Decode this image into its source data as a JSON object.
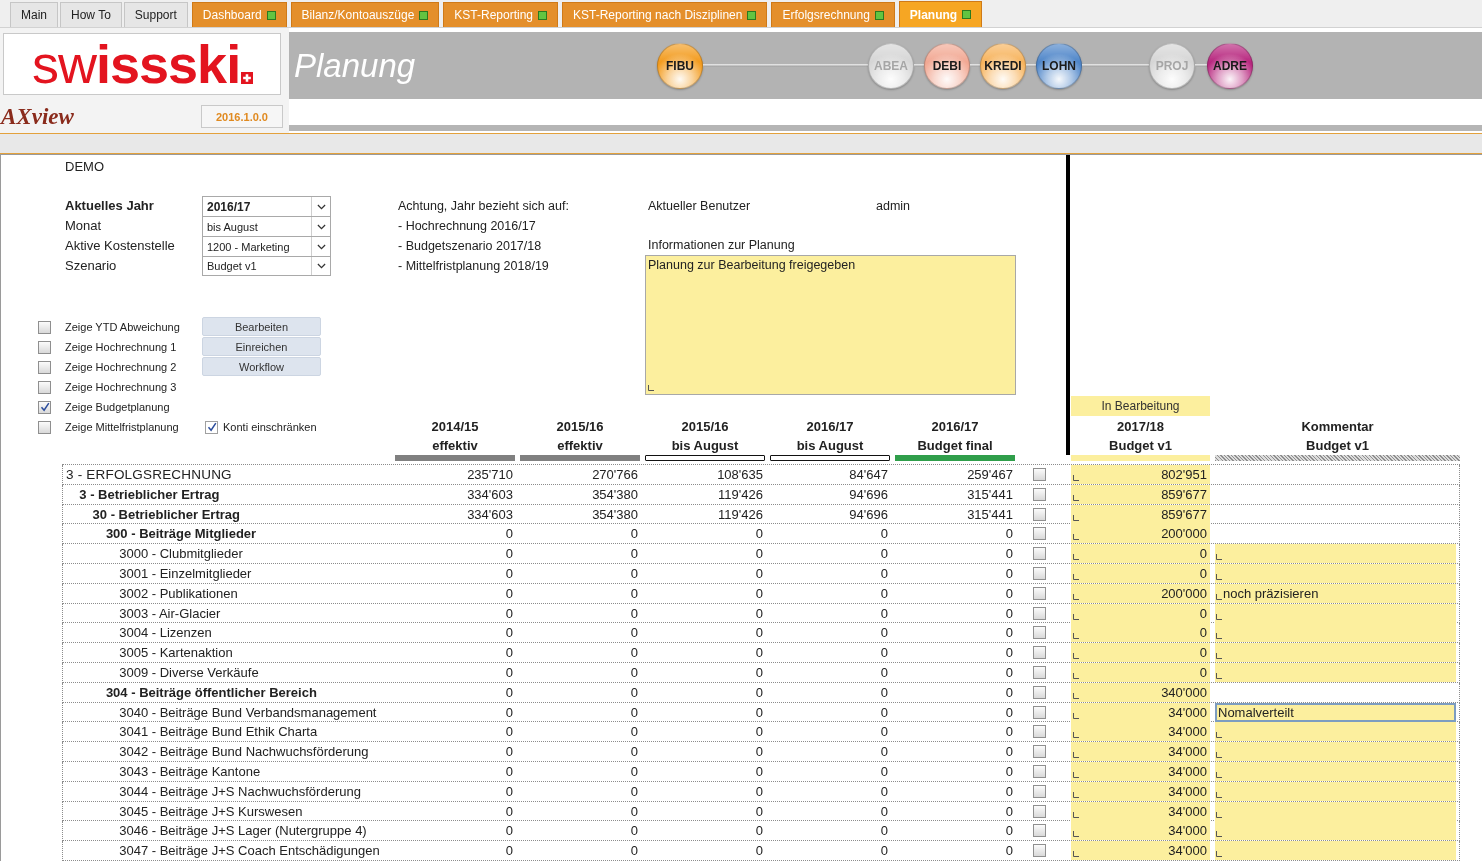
{
  "tabs": [
    {
      "label": "Main",
      "kind": "link",
      "selected": false
    },
    {
      "label": "How To",
      "kind": "link",
      "selected": false
    },
    {
      "label": "Support",
      "kind": "link",
      "selected": false
    },
    {
      "label": "Dashboard",
      "kind": "module",
      "selected": false
    },
    {
      "label": "Bilanz/Kontoauszüge",
      "kind": "module",
      "selected": false
    },
    {
      "label": "KST-Reporting",
      "kind": "module",
      "selected": false
    },
    {
      "label": "KST-Reporting nach Disziplinen",
      "kind": "module",
      "selected": false
    },
    {
      "label": "Erfolgsrechnung",
      "kind": "module",
      "selected": false
    },
    {
      "label": "Planung",
      "kind": "module",
      "selected": true
    }
  ],
  "header": {
    "logo": "sw**issski**",
    "product": "**AX**view",
    "version": "2016.1.0.0",
    "title": "Planung",
    "modules": [
      {
        "label": "FIBU",
        "color": "#f39c1f",
        "disabled": false
      },
      {
        "label": "ABEA",
        "disabled": true
      },
      {
        "label": "DEBI",
        "color": "#f2a994",
        "disabled": false
      },
      {
        "label": "KREDI",
        "color": "#f7b45e",
        "disabled": false
      },
      {
        "label": "LOHN",
        "color": "#4f86c9",
        "disabled": false
      },
      {
        "label": "PROJ",
        "disabled": true
      },
      {
        "label": "ADRE",
        "color": "#b8287f",
        "disabled": false
      }
    ]
  },
  "client": "DEMO",
  "settings": [
    {
      "label": "Aktuelles Jahr",
      "value": "2016/17"
    },
    {
      "label": "Monat",
      "value": "bis August"
    },
    {
      "label": "Aktive Kostenstelle",
      "value": "1200 - Marketing"
    },
    {
      "label": "Szenario",
      "value": "Budget v1"
    }
  ],
  "notice": {
    "title": "Achtung, Jahr bezieht sich auf:",
    "items": [
      "- Hochrechnung 2016/17",
      "- Budgetszenario 2017/18",
      "- Mittelfristplanung 2018/19"
    ]
  },
  "user": {
    "label": "Aktueller Benutzer",
    "value": "admin"
  },
  "info": {
    "label": "Informationen zur Planung",
    "value": "Planung zur Bearbeitung freigegeben"
  },
  "options": [
    {
      "label": "Zeige YTD Abweichung",
      "checked": false
    },
    {
      "label": "Zeige Hochrechnung 1",
      "checked": false
    },
    {
      "label": "Zeige Hochrechnung 2",
      "checked": false
    },
    {
      "label": "Zeige Hochrechnung 3",
      "checked": false
    },
    {
      "label": "Zeige Budgetplanung",
      "checked": true
    },
    {
      "label": "Zeige Mittelfristplanung",
      "checked": false
    }
  ],
  "actions": [
    "Bearbeiten",
    "Einreichen",
    "Workflow"
  ],
  "restrict": {
    "label": "Konti einschränken",
    "checked": true
  },
  "columns": [
    {
      "year": "2014/15",
      "label": "effektiv",
      "kind": "solid",
      "color": "#808080"
    },
    {
      "year": "2015/16",
      "label": "effektiv",
      "kind": "solid",
      "color": "#808080"
    },
    {
      "year": "2015/16",
      "label": "bis August",
      "kind": "outline"
    },
    {
      "year": "2016/17",
      "label": "bis August",
      "kind": "outline"
    },
    {
      "year": "2016/17",
      "label": "Budget final",
      "kind": "solid",
      "color": "#2f9e4a"
    }
  ],
  "budget_column": {
    "status": "In Bearbeitung",
    "year": "2017/18",
    "label": "Budget v1"
  },
  "comment_column": {
    "title": "Kommentar",
    "label": "Budget v1"
  },
  "rows": [
    {
      "label": "3 - ERFOLGSRECHNUNG",
      "values": [
        "235'710",
        "270'766",
        "108'635",
        "84'647",
        "259'467"
      ],
      "checked": false,
      "budget": "802'951",
      "children": [
        {
          "label": "3 - Betrieblicher Ertrag",
          "values": [
            "334'603",
            "354'380",
            "119'426",
            "94'696",
            "315'441"
          ],
          "checked": false,
          "budget": "859'677",
          "children": [
            {
              "label": "30 - Betrieblicher Ertrag",
              "values": [
                "334'603",
                "354'380",
                "119'426",
                "94'696",
                "315'441"
              ],
              "checked": false,
              "budget": "859'677",
              "children": [
                {
                  "label": "300 - Beiträge Mitglieder",
                  "values": [
                    "0",
                    "0",
                    "0",
                    "0",
                    "0"
                  ],
                  "checked": false,
                  "budget": "200'000",
                  "children": [
                    {
                      "label": "3000 - Clubmitglieder",
                      "values": [
                        "0",
                        "0",
                        "0",
                        "0",
                        "0"
                      ],
                      "checked": false,
                      "budget": "0",
                      "comment_focused": false
                    },
                    {
                      "label": "3001 - Einzelmitglieder",
                      "values": [
                        "0",
                        "0",
                        "0",
                        "0",
                        "0"
                      ],
                      "checked": false,
                      "budget": "0",
                      "comment_focused": false
                    },
                    {
                      "label": "3002 - Publikationen",
                      "values": [
                        "0",
                        "0",
                        "0",
                        "0",
                        "0"
                      ],
                      "checked": false,
                      "budget": "200'000",
                      "comment": "noch präzisieren",
                      "comment_focused": false
                    },
                    {
                      "label": "3003 - Air-Glacier",
                      "values": [
                        "0",
                        "0",
                        "0",
                        "0",
                        "0"
                      ],
                      "checked": false,
                      "budget": "0",
                      "comment_focused": false
                    },
                    {
                      "label": "3004 - Lizenzen",
                      "values": [
                        "0",
                        "0",
                        "0",
                        "0",
                        "0"
                      ],
                      "checked": false,
                      "budget": "0",
                      "comment_focused": false
                    },
                    {
                      "label": "3005 - Kartenaktion",
                      "values": [
                        "0",
                        "0",
                        "0",
                        "0",
                        "0"
                      ],
                      "checked": false,
                      "budget": "0",
                      "comment_focused": false
                    },
                    {
                      "label": "3009 - Diverse Verkäufe",
                      "values": [
                        "0",
                        "0",
                        "0",
                        "0",
                        "0"
                      ],
                      "checked": false,
                      "budget": "0",
                      "comment_focused": false
                    }
                  ]
                },
                {
                  "label": "304 - Beiträge öffentlicher Bereich",
                  "values": [
                    "0",
                    "0",
                    "0",
                    "0",
                    "0"
                  ],
                  "checked": false,
                  "budget": "340'000",
                  "children": [
                    {
                      "label": "3040 - Beiträge Bund Verbandsmanagement",
                      "values": [
                        "0",
                        "0",
                        "0",
                        "0",
                        "0"
                      ],
                      "checked": false,
                      "budget": "34'000",
                      "comment": "Nomalverteilt",
                      "comment_focused": true
                    },
                    {
                      "label": "3041 - Beiträge Bund Ethik Charta",
                      "values": [
                        "0",
                        "0",
                        "0",
                        "0",
                        "0"
                      ],
                      "checked": false,
                      "budget": "34'000",
                      "comment_focused": false
                    },
                    {
                      "label": "3042 - Beiträge Bund Nachwuchsförderung",
                      "values": [
                        "0",
                        "0",
                        "0",
                        "0",
                        "0"
                      ],
                      "checked": false,
                      "budget": "34'000",
                      "comment_focused": false
                    },
                    {
                      "label": "3043 - Beiträge Kantone",
                      "values": [
                        "0",
                        "0",
                        "0",
                        "0",
                        "0"
                      ],
                      "checked": false,
                      "budget": "34'000",
                      "comment_focused": false
                    },
                    {
                      "label": "3044 - Beiträge J+S Nachwuchsförderung",
                      "values": [
                        "0",
                        "0",
                        "0",
                        "0",
                        "0"
                      ],
                      "checked": false,
                      "budget": "34'000",
                      "comment_focused": false
                    },
                    {
                      "label": "3045 - Beiträge J+S Kurswesen",
                      "values": [
                        "0",
                        "0",
                        "0",
                        "0",
                        "0"
                      ],
                      "checked": false,
                      "budget": "34'000",
                      "comment_focused": false
                    },
                    {
                      "label": "3046 - Beiträge J+S Lager (Nutergruppe 4)",
                      "values": [
                        "0",
                        "0",
                        "0",
                        "0",
                        "0"
                      ],
                      "checked": false,
                      "budget": "34'000",
                      "comment_focused": false
                    },
                    {
                      "label": "3047 - Beiträge J+S Coach Entschädigungen",
                      "values": [
                        "0",
                        "0",
                        "0",
                        "0",
                        "0"
                      ],
                      "checked": false,
                      "budget": "34'000",
                      "comment_focused": false
                    }
                  ]
                }
              ]
            }
          ]
        }
      ]
    }
  ]
}
